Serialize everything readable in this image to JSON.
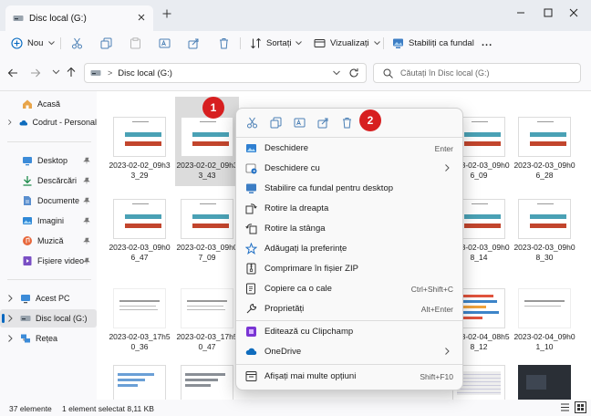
{
  "window": {
    "tab_title": "Disc local (G:)"
  },
  "toolbar": {
    "new_label": "Nou",
    "sort_label": "Sortați",
    "view_label": "Vizualizați",
    "wallpaper_label": "Stabiliți ca fundal",
    "more_label": "..."
  },
  "address": {
    "separator": ">",
    "location": "Disc local (G:)",
    "search_placeholder": "Căutați în Disc local (G:)"
  },
  "sidebar": {
    "items": [
      {
        "label": "Acasă"
      },
      {
        "label": "Codrut - Personal"
      },
      {
        "label": "Desktop"
      },
      {
        "label": "Descărcări"
      },
      {
        "label": "Documente"
      },
      {
        "label": "Imagini"
      },
      {
        "label": "Muzică"
      },
      {
        "label": "Fișiere video"
      },
      {
        "label": "Acest PC"
      },
      {
        "label": "Disc local (G:)"
      },
      {
        "label": "Rețea"
      }
    ]
  },
  "files": [
    {
      "name": "2023-02-02_09h33_29"
    },
    {
      "name": "2023-02-02_09h33_43"
    },
    {
      "name": "2023-02-03_09h06_09"
    },
    {
      "name": "2023-02-03_09h06_28"
    },
    {
      "name": "2023-02-03_09h06_47"
    },
    {
      "name": "2023-02-03_09h07_09"
    },
    {
      "name": "2023-02-03_09h08_14"
    },
    {
      "name": "2023-02-03_09h08_30"
    },
    {
      "name": "2023-02-03_17h50_36"
    },
    {
      "name": "2023-02-03_17h50_47"
    },
    {
      "name": "2023-02-04_08h58_12"
    },
    {
      "name": "2023-02-04_09h01_10"
    }
  ],
  "status": {
    "count": "37 elemente",
    "selection": "1 element selectat  8,11 KB"
  },
  "context_menu": {
    "items": [
      {
        "label": "Deschidere",
        "shortcut": "Enter"
      },
      {
        "label": "Deschidere cu",
        "shortcut": ""
      },
      {
        "label": "Stabilire ca fundal pentru desktop",
        "shortcut": ""
      },
      {
        "label": "Rotire la dreapta",
        "shortcut": ""
      },
      {
        "label": "Rotire la stânga",
        "shortcut": ""
      },
      {
        "label": "Adăugați la preferințe",
        "shortcut": ""
      },
      {
        "label": "Comprimare în fișier ZIP",
        "shortcut": ""
      },
      {
        "label": "Copiere ca o cale",
        "shortcut": "Ctrl+Shift+C"
      },
      {
        "label": "Proprietăți",
        "shortcut": "Alt+Enter"
      },
      {
        "label": "Editează cu Clipchamp",
        "shortcut": ""
      },
      {
        "label": "OneDrive",
        "shortcut": ""
      },
      {
        "label": "Afișați mai multe opțiuni",
        "shortcut": "Shift+F10"
      }
    ]
  },
  "callouts": {
    "one": "1",
    "two": "2"
  },
  "colors": {
    "accent": "#0067c0",
    "badge": "#d71f20",
    "selection": "#cfe3f7"
  }
}
